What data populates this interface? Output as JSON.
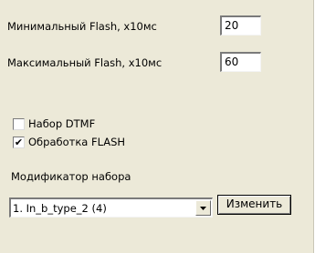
{
  "flash_settings": {
    "min_label": "Минимальный Flash, x10мс",
    "min_value": "20",
    "max_label": "Максимальный Flash, x10мс",
    "max_value": "60"
  },
  "options": {
    "dtmf_label": "Набор DTMF",
    "dtmf_checked": false,
    "flash_label": "Обработка FLASH",
    "flash_checked": true
  },
  "dial_modifier": {
    "label": "Модификатор набора",
    "selected": "1. In_b_type_2 (4)",
    "change_button": "Изменить"
  }
}
